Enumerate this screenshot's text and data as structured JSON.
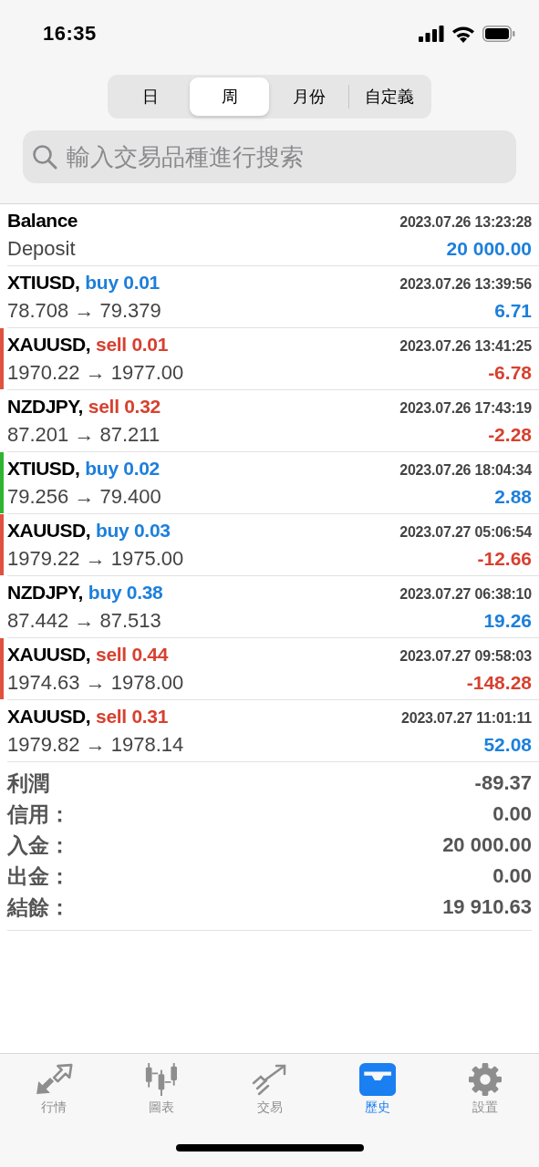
{
  "status_bar": {
    "time": "16:35"
  },
  "segments": [
    {
      "label": "日",
      "selected": false
    },
    {
      "label": "周",
      "selected": true
    },
    {
      "label": "月份",
      "selected": false
    },
    {
      "label": "自定義",
      "selected": false
    }
  ],
  "search": {
    "placeholder": "輸入交易品種進行搜索"
  },
  "rows": [
    {
      "kind": "balance",
      "title": "Balance",
      "time": "2023.07.26 13:23:28",
      "subtitle": "Deposit",
      "amount": "20 000.00",
      "loss": false
    },
    {
      "kind": "trade",
      "symbol": "XTIUSD,",
      "side": "buy",
      "lots": "0.01",
      "time": "2023.07.26 13:39:56",
      "prices": "78.708 → 79.379",
      "amount": "6.71",
      "loss": false
    },
    {
      "kind": "trade",
      "symbol": "XAUUSD,",
      "side": "sell",
      "lots": "0.01",
      "time": "2023.07.26 13:41:25",
      "prices": "1970.22 → 1977.00",
      "amount": "-6.78",
      "loss": true,
      "color": "#e0513f"
    },
    {
      "kind": "trade",
      "symbol": "NZDJPY,",
      "side": "sell",
      "lots": "0.32",
      "time": "2023.07.26 17:43:19",
      "prices": "87.201 → 87.211",
      "amount": "-2.28",
      "loss": true
    },
    {
      "kind": "trade",
      "symbol": "XTIUSD,",
      "side": "buy",
      "lots": "0.02",
      "time": "2023.07.26 18:04:34",
      "prices": "79.256 → 79.400",
      "amount": "2.88",
      "loss": false,
      "color": "#2fb52f"
    },
    {
      "kind": "trade",
      "symbol": "XAUUSD,",
      "side": "buy",
      "lots": "0.03",
      "time": "2023.07.27 05:06:54",
      "prices": "1979.22 → 1975.00",
      "amount": "-12.66",
      "loss": true,
      "color": "#e0513f"
    },
    {
      "kind": "trade",
      "symbol": "NZDJPY,",
      "side": "buy",
      "lots": "0.38",
      "time": "2023.07.27 06:38:10",
      "prices": "87.442 → 87.513",
      "amount": "19.26",
      "loss": false
    },
    {
      "kind": "trade",
      "symbol": "XAUUSD,",
      "side": "sell",
      "lots": "0.44",
      "time": "2023.07.27 09:58:03",
      "prices": "1974.63 → 1978.00",
      "amount": "-148.28",
      "loss": true,
      "color": "#e0513f"
    },
    {
      "kind": "trade",
      "symbol": "XAUUSD,",
      "side": "sell",
      "lots": "0.31",
      "time": "2023.07.27 11:01:11",
      "prices": "1979.82 → 1978.14",
      "amount": "52.08",
      "loss": false
    }
  ],
  "summary": [
    {
      "label": "利潤",
      "value": "-89.37"
    },
    {
      "label": "信用：",
      "value": "0.00"
    },
    {
      "label": "入金：",
      "value": "20 000.00"
    },
    {
      "label": "出金：",
      "value": "0.00"
    },
    {
      "label": "結餘：",
      "value": "19 910.63"
    }
  ],
  "tab_bar": [
    {
      "kind": "quotes",
      "label": "行情",
      "selected": false
    },
    {
      "kind": "chart",
      "label": "圖表",
      "selected": false
    },
    {
      "kind": "trade",
      "label": "交易",
      "selected": false
    },
    {
      "kind": "history",
      "label": "歷史",
      "selected": true
    },
    {
      "kind": "settings",
      "label": "設置",
      "selected": false
    }
  ]
}
